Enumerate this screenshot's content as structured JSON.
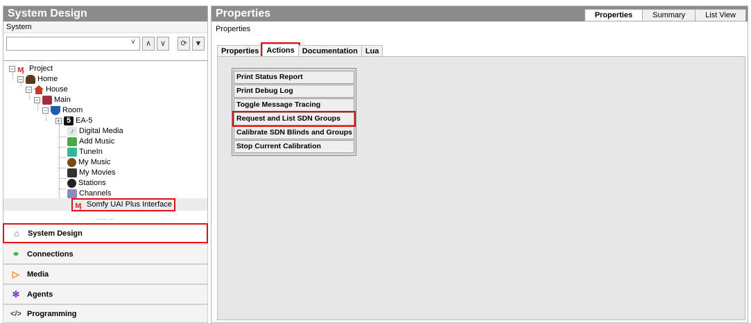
{
  "left": {
    "title": "System Design",
    "subheader": "System",
    "tree": [
      {
        "label": "Project",
        "icon": "project-icon"
      },
      {
        "label": "Home",
        "icon": "home-icon"
      },
      {
        "label": "House",
        "icon": "house-icon"
      },
      {
        "label": "Main",
        "icon": "floor-icon"
      },
      {
        "label": "Room",
        "icon": "room-icon"
      },
      {
        "label": "EA-5",
        "icon": "controller-icon"
      },
      {
        "label": "Digital Media",
        "icon": "digital-media-icon"
      },
      {
        "label": "Add Music",
        "icon": "add-music-icon"
      },
      {
        "label": "TuneIn",
        "icon": "tunein-icon"
      },
      {
        "label": "My Music",
        "icon": "my-music-icon"
      },
      {
        "label": "My Movies",
        "icon": "my-movies-icon"
      },
      {
        "label": "Stations",
        "icon": "stations-icon"
      },
      {
        "label": "Channels",
        "icon": "channels-icon"
      },
      {
        "label": "Somfy UAI Plus Interface",
        "icon": "driver-icon"
      }
    ],
    "nav": [
      {
        "label": "System Design",
        "icon": "system-design-icon"
      },
      {
        "label": "Connections",
        "icon": "connections-icon"
      },
      {
        "label": "Media",
        "icon": "media-icon"
      },
      {
        "label": "Agents",
        "icon": "agents-icon"
      },
      {
        "label": "Programming",
        "icon": "programming-icon"
      }
    ]
  },
  "right": {
    "title": "Properties",
    "top_tabs": [
      "Properties",
      "Summary",
      "List View"
    ],
    "subheader": "Properties",
    "tabs": [
      "Properties",
      "Actions",
      "Documentation",
      "Lua"
    ],
    "actions": [
      "Print Status Report",
      "Print Debug Log",
      "Toggle Message Tracing",
      "Request and List SDN Groups",
      "Calibrate SDN Blinds and Groups",
      "Stop Current Calibration"
    ]
  },
  "colors": {
    "highlight": "#e01010",
    "header_bg": "#8c8c8c"
  }
}
